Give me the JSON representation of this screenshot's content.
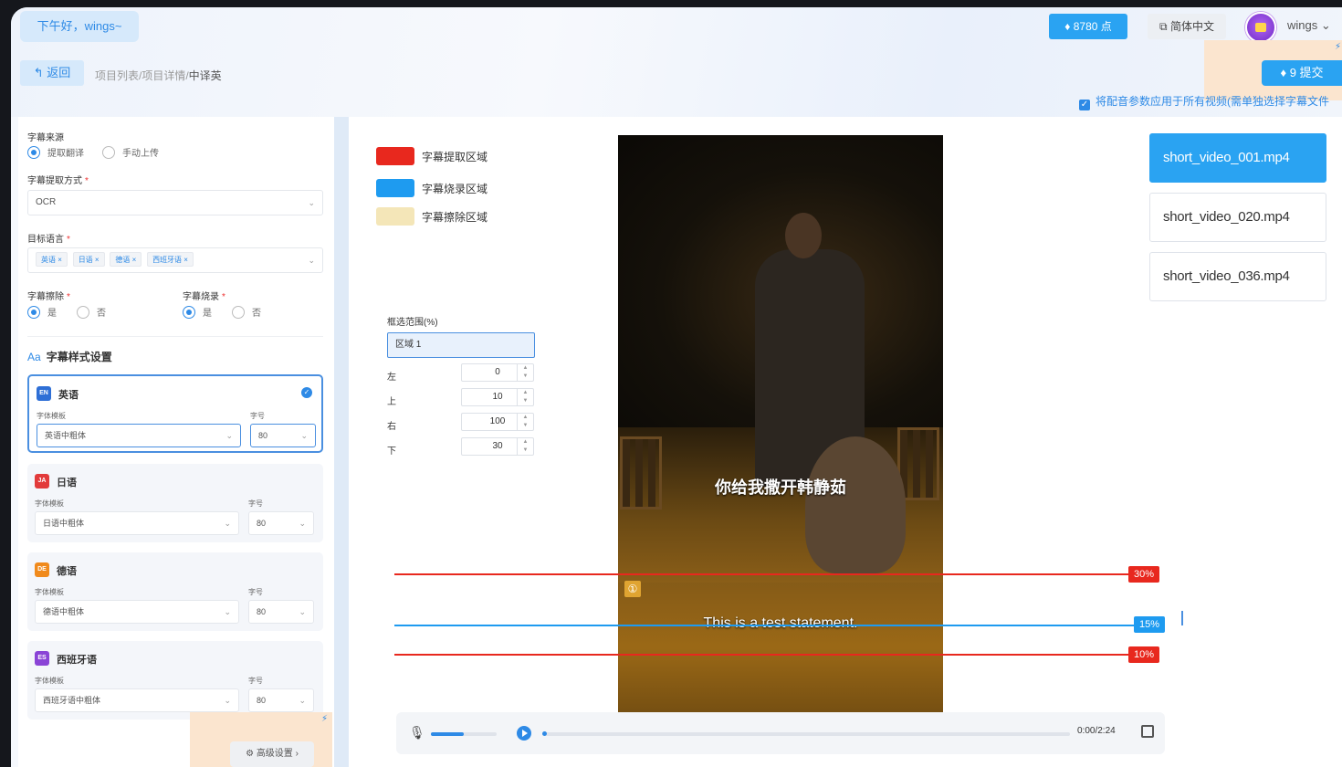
{
  "header": {
    "greeting": "下午好，wings~",
    "points": "8780 点",
    "language": "简体中文",
    "username": "wings"
  },
  "nav": {
    "back_label": "返回",
    "breadcrumb_path": "项目列表/项目详情/",
    "breadcrumb_current": "中译英",
    "submit_label": "9 提交",
    "apply_all_label": "将配音参数应用于所有视频(需单独选择字幕文件"
  },
  "settings": {
    "subtitle_source_label": "字幕来源",
    "source_options": [
      "提取翻译",
      "手动上传"
    ],
    "source_selected": 0,
    "extract_method_label": "字幕提取方式",
    "extract_method_value": "OCR",
    "target_lang_label": "目标语言",
    "target_langs": [
      "英语",
      "日语",
      "德语",
      "西班牙语"
    ],
    "erase_label": "字幕擦除",
    "burn_label": "字幕烧录",
    "yes": "是",
    "no": "否",
    "style_title": "字幕样式设置",
    "font_template_label": "字体模板",
    "font_size_label": "字号",
    "lang_cards": [
      {
        "code": "EN",
        "name": "英语",
        "font": "英语中粗体",
        "size": "80",
        "color": "#2e6fd6",
        "active": true
      },
      {
        "code": "JA",
        "name": "日语",
        "font": "日语中粗体",
        "size": "80",
        "color": "#e23b3b",
        "active": false
      },
      {
        "code": "DE",
        "name": "德语",
        "font": "德语中粗体",
        "size": "80",
        "color": "#f08a1c",
        "active": false
      },
      {
        "code": "ES",
        "name": "西班牙语",
        "font": "西班牙语中粗体",
        "size": "80",
        "color": "#8a44d6",
        "active": false
      }
    ],
    "advanced_label": "高级设置"
  },
  "legend": [
    {
      "label": "字幕提取区域",
      "color": "#e8281e"
    },
    {
      "label": "字幕烧录区域",
      "color": "#1e9bf0"
    },
    {
      "label": "字幕擦除区域",
      "color": "#f4e6b8"
    }
  ],
  "range": {
    "title": "框选范围(%)",
    "region": "区域 1",
    "fields": [
      {
        "label": "左",
        "value": "0"
      },
      {
        "label": "上",
        "value": "10"
      },
      {
        "label": "右",
        "value": "100"
      },
      {
        "label": "下",
        "value": "30"
      }
    ]
  },
  "video": {
    "subtitle_cn": "你给我撒开韩静茹",
    "subtitle_en": "This is a test statement.",
    "marker": "①",
    "lines": [
      {
        "pct": "30%",
        "color": "#e8281e"
      },
      {
        "pct": "15%",
        "color": "#1e9bf0"
      },
      {
        "pct": "10%",
        "color": "#e8281e"
      }
    ]
  },
  "player": {
    "time": "0:00/2:24",
    "volume": 0.5,
    "progress": 0.0
  },
  "files": [
    "short_video_001.mp4",
    "short_video_020.mp4",
    "short_video_036.mp4"
  ],
  "selected_file": 0
}
